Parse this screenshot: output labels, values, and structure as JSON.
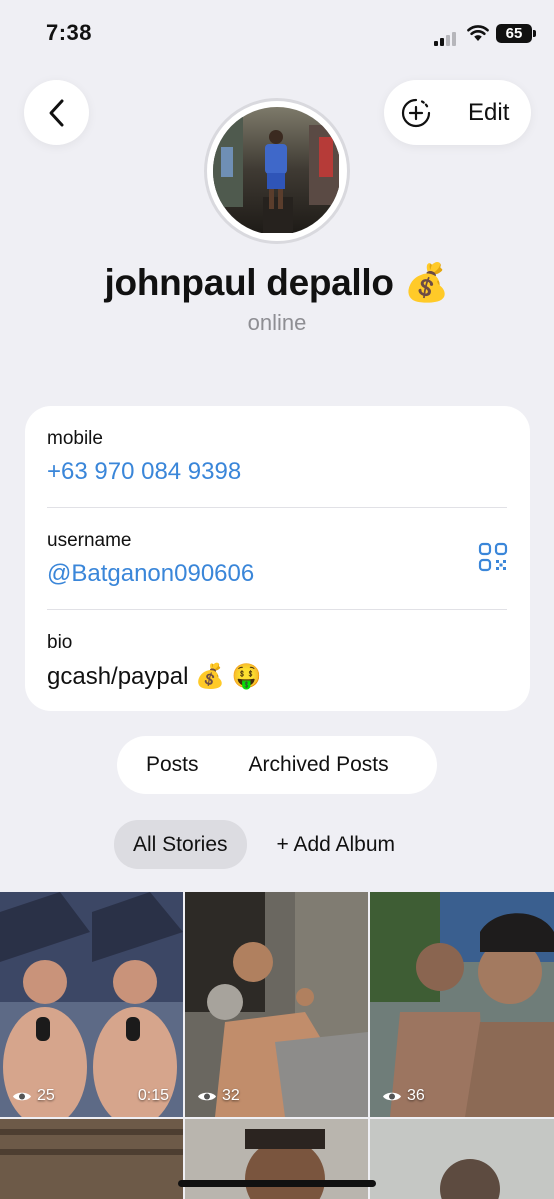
{
  "status_bar": {
    "time": "7:38",
    "battery": "65"
  },
  "header": {
    "edit_label": "Edit"
  },
  "profile": {
    "name": "johnpaul depallo 💰",
    "presence": "online"
  },
  "info": {
    "mobile_label": "mobile",
    "mobile_value": "+63 970 084 9398",
    "username_label": "username",
    "username_value": "@Batganon090606",
    "bio_label": "bio",
    "bio_value": "gcash/paypal 💰 🤑"
  },
  "tabs": {
    "posts": "Posts",
    "archived": "Archived Posts"
  },
  "albums": {
    "all_stories": "All Stories",
    "add_album": "+ Add Album"
  },
  "stories": [
    {
      "views": "25",
      "duration": "0:15"
    },
    {
      "views": "32"
    },
    {
      "views": "36"
    }
  ],
  "colors": {
    "accent": "#3a86d9",
    "background": "#efeff4",
    "card": "#ffffff"
  }
}
